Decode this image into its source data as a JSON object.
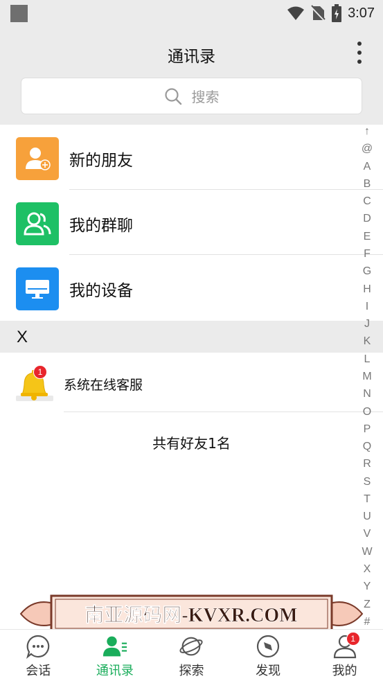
{
  "status_bar": {
    "time": "3:07"
  },
  "header": {
    "title": "通讯录",
    "search_placeholder": "搜索"
  },
  "quick_items": [
    {
      "label": "新的朋友",
      "icon": "add-friend-icon",
      "color": "#f7a13b"
    },
    {
      "label": "我的群聊",
      "icon": "group-chat-icon",
      "color": "#1ec065"
    },
    {
      "label": "我的设备",
      "icon": "device-icon",
      "color": "#1c8ef0"
    }
  ],
  "section": {
    "letter": "X"
  },
  "contacts": [
    {
      "name": "系统在线客服",
      "icon": "bell-icon",
      "badge": "1"
    }
  ],
  "friend_count": "共有好友1名",
  "index_letters": [
    "↑",
    "@",
    "A",
    "B",
    "C",
    "D",
    "E",
    "F",
    "G",
    "H",
    "I",
    "J",
    "K",
    "L",
    "M",
    "N",
    "O",
    "P",
    "Q",
    "R",
    "S",
    "T",
    "U",
    "V",
    "W",
    "X",
    "Y",
    "Z",
    "#"
  ],
  "watermark": "南亚源码网-KVXR.COM",
  "tabs": [
    {
      "label": "会话",
      "icon": "chat-icon",
      "active": false
    },
    {
      "label": "通讯录",
      "icon": "contacts-icon",
      "active": true
    },
    {
      "label": "探索",
      "icon": "planet-icon",
      "active": false
    },
    {
      "label": "发现",
      "icon": "compass-icon",
      "active": false
    },
    {
      "label": "我的",
      "icon": "profile-icon",
      "active": false,
      "badge": "1"
    }
  ],
  "colors": {
    "accent": "#1aad5b",
    "header_bg": "#ebebeb",
    "badge": "#e8262c"
  }
}
